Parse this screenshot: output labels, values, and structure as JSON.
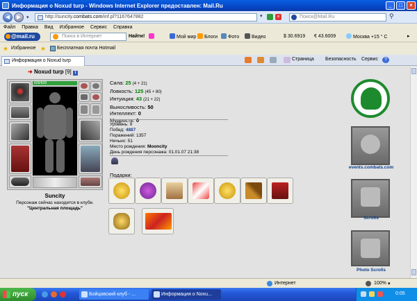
{
  "window": {
    "title": "Информация о Noxud turp - Windows Internet Explorer предоставлен: Mail.Ru",
    "min": "_",
    "max": "□",
    "close": "×"
  },
  "address": {
    "url_prefix": "http://suncity.",
    "url_domain": "combats.com",
    "url_path": "/inf.pl?1167647882",
    "search_placeholder": "Поиск@Mail.Ru"
  },
  "menu": [
    "Файл",
    "Правка",
    "Вид",
    "Избранное",
    "Сервис",
    "Справка"
  ],
  "mailru_toolbar": {
    "logo": "@mail.ru",
    "search_placeholder": "Поиск в Интернет",
    "find": "Найти!",
    "items": [
      "Мой мир",
      "Блоги",
      "Фото",
      "Видео"
    ],
    "usd": "$ 30.6919",
    "eur": "€ 43.6009",
    "weather": "Москва +15 ° C"
  },
  "favorites": {
    "label": "Избранное",
    "link": "Бесплатная почта Hotmail"
  },
  "tab": {
    "title": "Информация о Noxud turp",
    "commands": [
      "Страница",
      "Безопасность",
      "Сервис"
    ]
  },
  "character": {
    "name": "Noxud turp",
    "level": "[9]",
    "hp": "828/828",
    "stats": {
      "strength_label": "Сила:",
      "strength": "25",
      "strength_extra": "(4 + 21)",
      "agility_label": "Ловкость:",
      "agility": "125",
      "agility_extra": "(45 + 80)",
      "intuition_label": "Интуиция:",
      "intuition": "43",
      "intuition_extra": "(21 + 22)",
      "endurance_label": "Выносливость:",
      "endurance": "50",
      "intellect_label": "Интеллект:",
      "intellect": "0",
      "wisdom_label": "Мудрость:",
      "wisdom": "0"
    },
    "info": {
      "level_label": "Уровень:",
      "level": "9",
      "wins_label": "Побед:",
      "wins": "4887",
      "losses_label": "Поражений:",
      "losses": "1357",
      "draws_label": "Ничьих:",
      "draws": "51",
      "birthplace_label": "Место рождения:",
      "birthplace": "Mooncity",
      "birthday_label": "День рождения персонажа:",
      "birthday": "01.01.07 21:38"
    },
    "city": "Suncity",
    "location_text": "Персонаж сейчас находится в клубе.",
    "location": "\"Центральная площадь\"",
    "gifts_label": "Подарки:"
  },
  "sidebar_links": [
    "events.combats.com",
    "Scrolls",
    "Photo Scrolls"
  ],
  "status": {
    "zone": "Интернет",
    "zoom": "100%"
  },
  "taskbar": {
    "start": "пуск",
    "tasks": [
      "Бойцовский клуб - ...",
      "Информация о Noxu..."
    ],
    "clock": "0:05"
  },
  "colors": {
    "stat_green": "#008000",
    "title_blue": "#0a4cd8",
    "emblem_green": "#1e8a2e"
  }
}
